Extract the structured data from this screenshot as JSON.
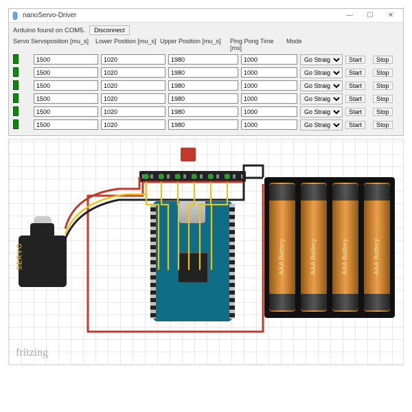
{
  "window": {
    "title": "nanoServo-Driver",
    "min": "—",
    "max": "☐",
    "close": "✕"
  },
  "toolbar": {
    "status": "Arduino found on COM5.",
    "disconnect": "Disconnect"
  },
  "headers": {
    "servo": "Servo",
    "pos": "Servoposition [mu_s]",
    "lower": "Lower Position [mu_s]",
    "upper": "Upper Position [mu_s]",
    "ping": "Ping Pong Time [ms]",
    "mode": "Mode",
    "start": "",
    "stop": ""
  },
  "mode_options": [
    "Go Straight"
  ],
  "start_label": "Start",
  "stop_label": "Stop",
  "rows": [
    {
      "pos": "1500",
      "lower": "1020",
      "upper": "1980",
      "ping": "1000",
      "mode": "Go Straight"
    },
    {
      "pos": "1500",
      "lower": "1020",
      "upper": "1980",
      "ping": "1000",
      "mode": "Go Straight"
    },
    {
      "pos": "1500",
      "lower": "1020",
      "upper": "1980",
      "ping": "1000",
      "mode": "Go Straight"
    },
    {
      "pos": "1500",
      "lower": "1020",
      "upper": "1980",
      "ping": "1000",
      "mode": "Go Straight"
    },
    {
      "pos": "1500",
      "lower": "1020",
      "upper": "1980",
      "ping": "1000",
      "mode": "Go Straight"
    },
    {
      "pos": "1500",
      "lower": "1020",
      "upper": "1980",
      "ping": "1000",
      "mode": "Go Straight"
    }
  ],
  "circuit": {
    "servo_label": "SERVO",
    "battery_label": "AAA Battery",
    "watermark": "fritzing"
  }
}
